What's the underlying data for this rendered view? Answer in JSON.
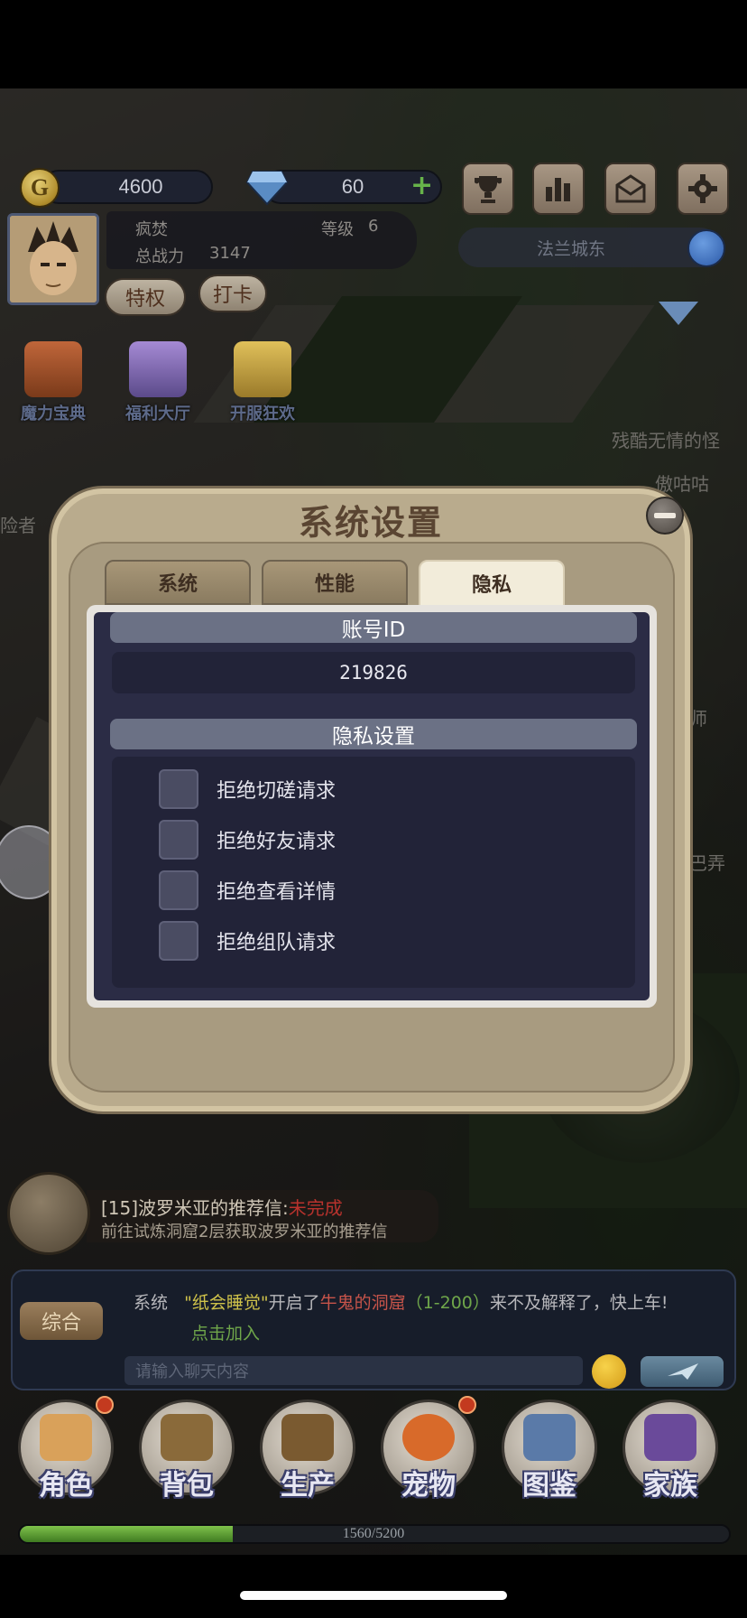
{
  "hud": {
    "gold": "4600",
    "diamonds": "60",
    "player_name": "疯焚",
    "level_label": "等级",
    "level_value": "6",
    "power_label": "总战力",
    "power_value": "3147",
    "privilege_btn": "特权",
    "checkin_btn": "打卡",
    "location": "法兰城东",
    "icons": [
      "trophy-icon",
      "ranking-icon",
      "mail-icon",
      "gear-icon"
    ]
  },
  "events": [
    {
      "label": "魔力宝典",
      "color": "#a0522d"
    },
    {
      "label": "福利大厅",
      "color": "#7b6bb0"
    },
    {
      "label": "开服狂欢",
      "color": "#c8a23a"
    }
  ],
  "world_labels": [
    "残酷无情的怪",
    "傲咕咕",
    "险者",
    "师",
    "巴弄"
  ],
  "dialog": {
    "title": "系统设置",
    "tabs": [
      {
        "label": "系统",
        "active": false
      },
      {
        "label": "性能",
        "active": false
      },
      {
        "label": "隐私",
        "active": true
      }
    ],
    "account_header": "账号ID",
    "account_id": "219826",
    "privacy_header": "隐私设置",
    "options": [
      {
        "label": "拒绝切磋请求",
        "checked": false
      },
      {
        "label": "拒绝好友请求",
        "checked": false
      },
      {
        "label": "拒绝查看详情",
        "checked": false
      },
      {
        "label": "拒绝组队请求",
        "checked": false
      }
    ]
  },
  "quest": {
    "title": "[15]波罗米亚的推荐信:",
    "status": "未完成",
    "desc": "前往试炼洞窟2层获取波罗米亚的推荐信"
  },
  "chat": {
    "tab_label": "综合",
    "channel": "系统",
    "msg_player": "\"纸会睡觉\"",
    "msg_opened": "开启了",
    "msg_place": "牛鬼的洞窟",
    "msg_range": "（1-200）",
    "msg_rest": "来不及解释了，快上车!",
    "join_link": "点击加入",
    "input_placeholder": "请输入聊天内容"
  },
  "nav": [
    {
      "label": "角色",
      "badge": true,
      "color": "#d9a15a"
    },
    {
      "label": "背包",
      "badge": false,
      "color": "#8a6a3a"
    },
    {
      "label": "生产",
      "badge": false,
      "color": "#7a5a30"
    },
    {
      "label": "宠物",
      "badge": true,
      "color": "#d86a2a"
    },
    {
      "label": "图鉴",
      "badge": false,
      "color": "#5a7aa8"
    },
    {
      "label": "家族",
      "badge": false,
      "color": "#6a4a9a"
    }
  ],
  "xp": {
    "text": "1560/5200",
    "current": 1560,
    "max": 5200
  }
}
